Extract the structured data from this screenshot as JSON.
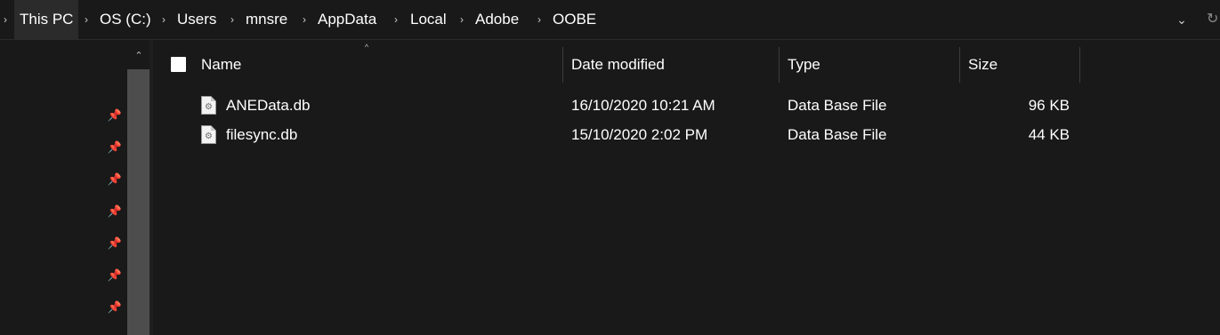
{
  "breadcrumb": {
    "segments": [
      "This PC",
      "OS (C:)",
      "Users",
      "mnsre",
      "AppData",
      "Local",
      "Adobe",
      "OOBE"
    ]
  },
  "icons": {
    "chevron": "›",
    "dropdown": "⌄",
    "refresh": "↻",
    "pin": "📌",
    "scroll_up": "⌃",
    "sort_caret": "^",
    "gear": "⚙"
  },
  "columns": {
    "name": "Name",
    "date_modified": "Date modified",
    "type": "Type",
    "size": "Size"
  },
  "files": [
    {
      "name": "ANEData.db",
      "date_modified": "16/10/2020 10:21 AM",
      "type": "Data Base File",
      "size": "96 KB"
    },
    {
      "name": "filesync.db",
      "date_modified": "15/10/2020 2:02 PM",
      "type": "Data Base File",
      "size": "44 KB"
    }
  ],
  "colors": {
    "background": "#191919",
    "text": "#ffffff",
    "scrollbar_thumb": "#4d4d4d"
  }
}
